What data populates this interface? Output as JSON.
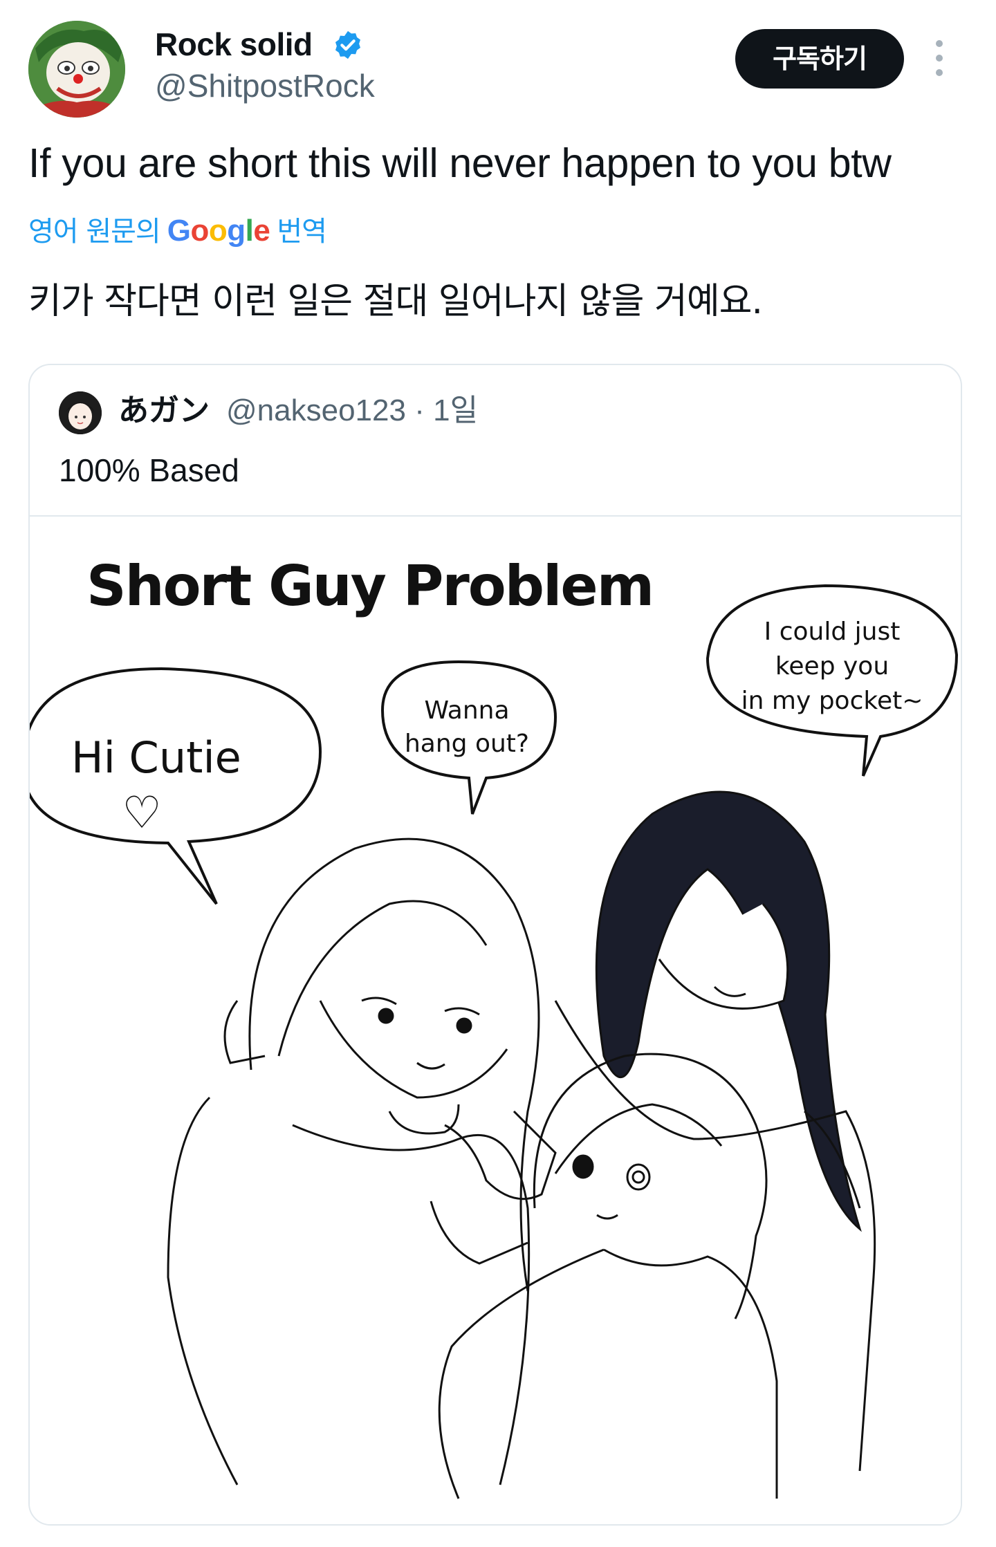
{
  "author": {
    "name": "Rock solid",
    "handle": "@ShitpostRock",
    "verified": true,
    "avatar": "clown-avatar"
  },
  "subscribe_label": "구독하기",
  "tweet": {
    "text": "If you are short this will never happen to you btw",
    "translation_source": "영어 원문의",
    "translation_brand": "Google",
    "translation_suffix": "번역",
    "translated_text": "키가 작다면 이런 일은 절대 일어나지 않을 거예요."
  },
  "quote": {
    "author_name": "あガン",
    "handle": "@nakseo123",
    "separator": "·",
    "time": "1일",
    "text": "100% Based",
    "image": {
      "title": "Short Guy Problem",
      "bubble_left_line1": "Hi Cutie",
      "bubble_left_heart": "♡",
      "bubble_middle_line1": "Wanna",
      "bubble_middle_line2": "hang out?",
      "bubble_right_line1": "I could just",
      "bubble_right_line2": "keep you",
      "bubble_right_line3": "in my pocket~"
    }
  },
  "colors": {
    "link": "#1d9bf0",
    "secondary_text": "#536471",
    "border": "#e1e8ed",
    "button_bg": "#0f1419"
  },
  "icons": {
    "verified": "verified-badge-icon",
    "more": "more-options-icon"
  }
}
